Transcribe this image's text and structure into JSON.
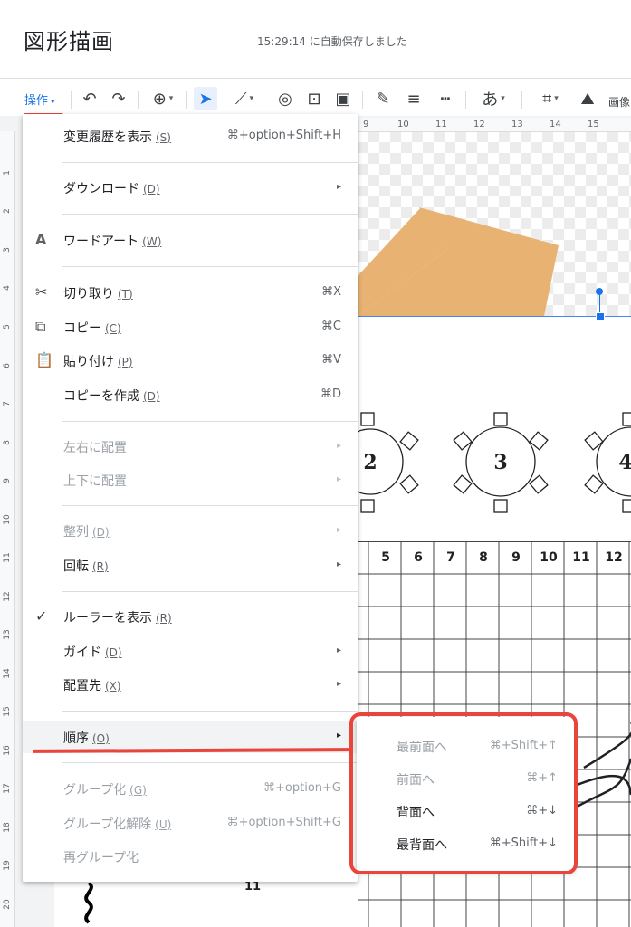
{
  "header": {
    "title": "図形描画",
    "autosave": "15:29:14 に自動保存しました"
  },
  "toolbar": {
    "menu_label": "操作",
    "partial_label": "画像",
    "icons": [
      "undo-icon",
      "redo-icon",
      "zoom-icon",
      "select-icon",
      "line-icon",
      "shape-icon",
      "textbox-icon",
      "image-icon",
      "pen-icon",
      "line-weight-icon",
      "line-dash-icon",
      "text-style-icon",
      "crop-icon",
      "replace-image-icon"
    ],
    "text_style_label": "あ"
  },
  "ruler": {
    "top": [
      "9",
      "10",
      "11",
      "12",
      "13",
      "14",
      "15"
    ],
    "left": [
      "1",
      "2",
      "3",
      "4",
      "5",
      "6",
      "7",
      "8",
      "9",
      "10",
      "11",
      "12",
      "13",
      "14",
      "15",
      "16",
      "17",
      "18",
      "19",
      "20"
    ]
  },
  "menu": {
    "items": [
      {
        "label": "変更履歴を表示",
        "accel": "(S)",
        "shortcut": "⌘+option+Shift+H"
      },
      {
        "label": "ダウンロード",
        "accel": "(D)",
        "submenu": "▸"
      },
      {
        "label": "ワードアート",
        "accel": "(W)",
        "icon": "wordart-icon"
      },
      {
        "label": "切り取り",
        "accel": "(T)",
        "shortcut": "⌘X",
        "icon": "scissors-icon"
      },
      {
        "label": "コピー",
        "accel": "(C)",
        "shortcut": "⌘C",
        "icon": "copy-icon"
      },
      {
        "label": "貼り付け",
        "accel": "(P)",
        "shortcut": "⌘V",
        "icon": "clipboard-icon"
      },
      {
        "label": "コピーを作成",
        "accel": "(D)",
        "shortcut": "⌘D"
      },
      {
        "label": "左右に配置",
        "submenu": "▸",
        "disabled": true
      },
      {
        "label": "上下に配置",
        "submenu": "▸",
        "disabled": true
      },
      {
        "label": "整列",
        "accel": "(D)",
        "submenu": "▸",
        "disabled": true
      },
      {
        "label": "回転",
        "accel": "(R)",
        "submenu": "▸"
      },
      {
        "label": "ルーラーを表示",
        "accel": "(R)",
        "icon": "checkmark-icon"
      },
      {
        "label": "ガイド",
        "accel": "(D)",
        "submenu": "▸"
      },
      {
        "label": "配置先",
        "accel": "(X)",
        "submenu": "▸"
      },
      {
        "label": "順序",
        "accel": "(O)",
        "submenu": "▸",
        "highlighted": true
      },
      {
        "label": "グループ化",
        "accel": "(G)",
        "shortcut": "⌘+option+G",
        "disabled": true
      },
      {
        "label": "グループ化解除",
        "accel": "(U)",
        "shortcut": "⌘+option+Shift+G",
        "disabled": true
      },
      {
        "label": "再グループ化",
        "disabled": true
      }
    ]
  },
  "submenu": {
    "items": [
      {
        "label": "最前面へ",
        "shortcut": "⌘+Shift+↑",
        "disabled": true
      },
      {
        "label": "前面へ",
        "shortcut": "⌘+↑",
        "disabled": true
      },
      {
        "label": "背面へ",
        "shortcut": "⌘+↓"
      },
      {
        "label": "最背面へ",
        "shortcut": "⌘+Shift+↓"
      }
    ]
  },
  "canvas": {
    "tables": [
      "2",
      "3",
      "4"
    ],
    "grid_headers": [
      "5",
      "6",
      "7",
      "8",
      "9",
      "10",
      "11",
      "12"
    ],
    "bottom_label": "11",
    "shape_color": "#e8b273",
    "annotation_color": "#e8453c"
  }
}
